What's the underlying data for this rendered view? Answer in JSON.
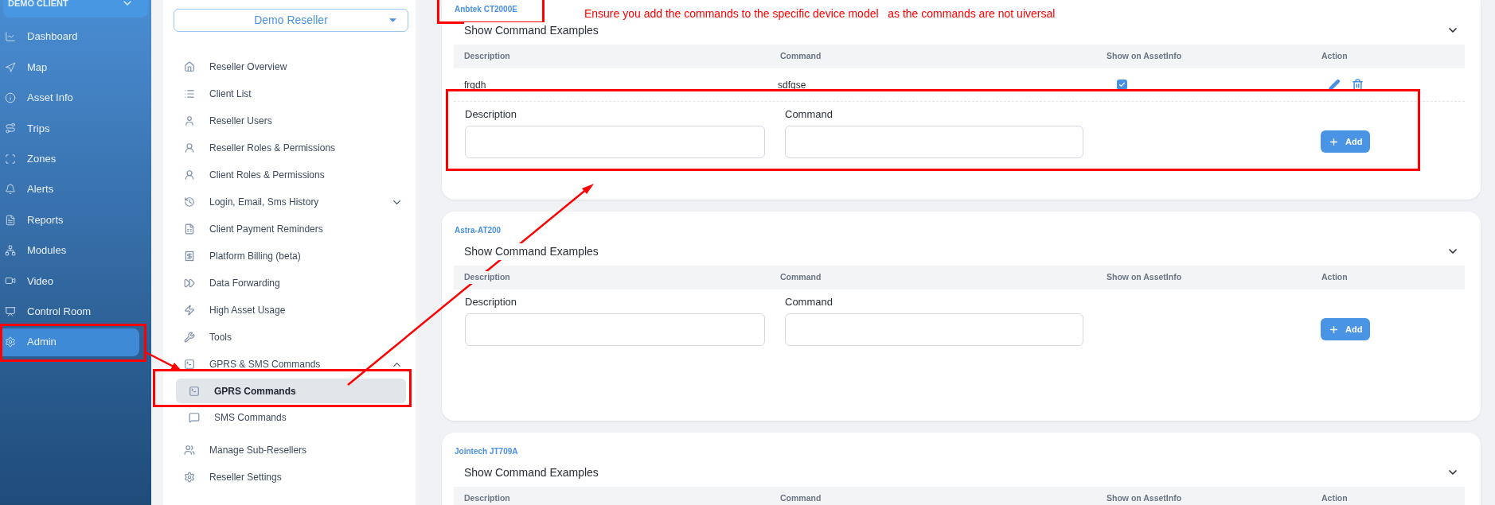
{
  "sidebar": {
    "client_selector": "DEMO CLIENT",
    "items": [
      {
        "label": "Dashboard",
        "selected": false
      },
      {
        "label": "Map",
        "selected": false
      },
      {
        "label": "Asset Info",
        "selected": false
      },
      {
        "label": "Trips",
        "selected": false
      },
      {
        "label": "Zones",
        "selected": false
      },
      {
        "label": "Alerts",
        "selected": false
      },
      {
        "label": "Reports",
        "selected": false
      },
      {
        "label": "Modules",
        "selected": false
      },
      {
        "label": "Video",
        "selected": false
      },
      {
        "label": "Control Room",
        "selected": false
      },
      {
        "label": "Admin",
        "selected": true
      }
    ]
  },
  "admin_menu": {
    "reseller_selector": "Demo Reseller",
    "items": [
      {
        "label": "Reseller Overview",
        "selected": false
      },
      {
        "label": "Client List",
        "selected": false
      },
      {
        "label": "Reseller Users",
        "selected": false
      },
      {
        "label": "Reseller Roles & Permissions",
        "selected": false
      },
      {
        "label": "Client Roles & Permissions",
        "selected": false
      },
      {
        "label": "Login, Email, Sms History",
        "selected": false,
        "expanded": false
      },
      {
        "label": "Client Payment Reminders",
        "selected": false
      },
      {
        "label": "Platform Billing (beta)",
        "selected": false
      },
      {
        "label": "Data Forwarding",
        "selected": false
      },
      {
        "label": "High Asset Usage",
        "selected": false
      },
      {
        "label": "Tools",
        "selected": false
      },
      {
        "label": "GPRS & SMS Commands",
        "selected": false,
        "expanded": true,
        "children": [
          {
            "label": "GPRS Commands",
            "selected": true
          },
          {
            "label": "SMS Commands",
            "selected": false
          }
        ]
      },
      {
        "label": "Manage Sub-Resellers",
        "selected": false
      },
      {
        "label": "Reseller Settings",
        "selected": false
      }
    ]
  },
  "device_cards": [
    {
      "model": "Anbtek CT2000E",
      "annotation": "Ensure you add the commands to the specific device model   as the commands are not uiversal",
      "examples_toggle": "Show Command Examples",
      "examples_expanded": false,
      "columns": [
        "Description",
        "Command",
        "Show on AssetInfo",
        "Action"
      ],
      "rows": [
        {
          "description": "frgdh",
          "command": "sdfgse",
          "show_on_assetinfo": true
        }
      ],
      "form": {
        "description_label": "Description",
        "command_label": "Command",
        "add_button": "Add"
      }
    },
    {
      "model": "Astra-AT200",
      "examples_toggle": "Show Command Examples",
      "examples_expanded": false,
      "columns": [
        "Description",
        "Command",
        "Show on AssetInfo",
        "Action"
      ],
      "form": {
        "description_label": "Description",
        "command_label": "Command",
        "add_button": "Add"
      }
    },
    {
      "model": "Jointech JT709A",
      "examples_toggle": "Show Command Examples",
      "examples_expanded": false,
      "columns": [
        "Description",
        "Command",
        "Show on AssetInfo",
        "Action"
      ]
    }
  ]
}
